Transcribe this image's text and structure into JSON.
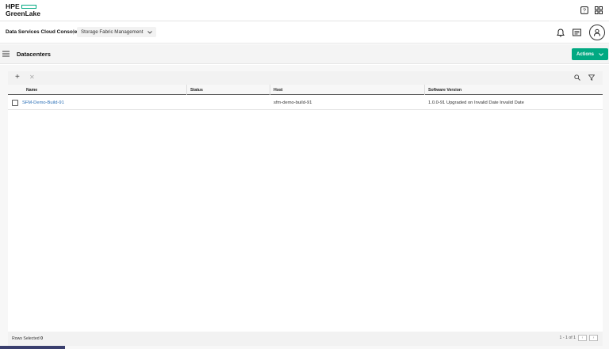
{
  "brand": {
    "line1": "HPE",
    "line2": "GreenLake",
    "accent": "#01a982"
  },
  "top_icons": [
    "help-icon",
    "app-grid-icon"
  ],
  "console": {
    "title": "Data Services Cloud Console",
    "separator": "|",
    "service_selected": "Storage Fabric Management",
    "right_icons": [
      "bell-icon",
      "news-icon",
      "user-avatar-icon"
    ]
  },
  "page": {
    "title": "Datacenters",
    "actions_label": "Actions"
  },
  "table": {
    "columns": [
      "Name",
      "Status",
      "Host",
      "Software Version"
    ],
    "rows": [
      {
        "name": "SFM-Demo-Build-91",
        "status": "",
        "host": "sfm-demo-build-91",
        "software_version": "1.0.0-91 Upgraded on Invalid Date Invalid Date"
      }
    ]
  },
  "footer": {
    "rows_selected_label": "Rows Selected",
    "rows_selected_count": "0",
    "pagination": "1 - 1 of 1"
  },
  "colors": {
    "primary_button": "#01a982",
    "link": "#2b6fb6"
  }
}
